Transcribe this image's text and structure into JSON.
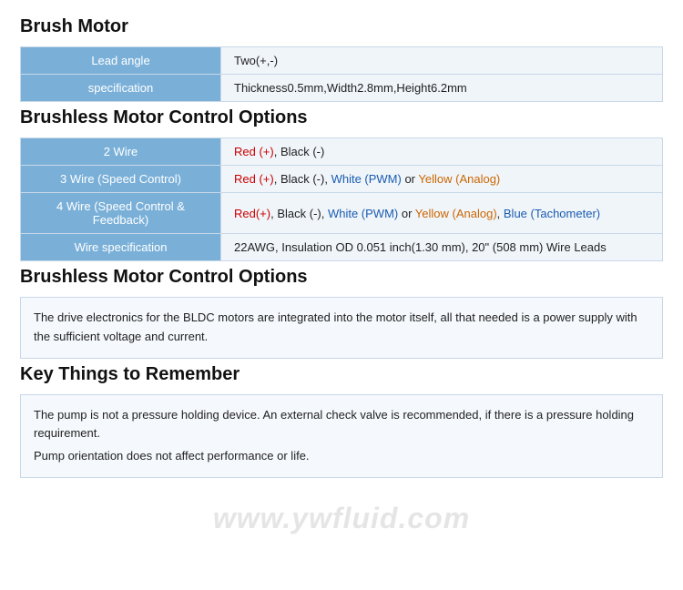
{
  "sections": {
    "brush_motor": {
      "title": "Brush Motor",
      "rows": [
        {
          "label": "Lead angle",
          "value_plain": "Two(+,-)"
        },
        {
          "label": "specification",
          "value_plain": "Thickness0.5mm,Width2.8mm,Height6.2mm"
        }
      ]
    },
    "brushless_control_options": {
      "title": "Brushless Motor Control Options",
      "rows": [
        {
          "label": "2 Wire",
          "value_html": "<span class='red'>Red (+)</span>, <span>Black (-)</span>"
        },
        {
          "label": "3 Wire (Speed Control)",
          "value_html": "<span class='red'>Red (+)</span>, Black (-), <span class='blue'>White (PWM)</span> or <span class='orange'>Yellow (Analog)</span>"
        },
        {
          "label": "4 Wire (Speed Control & Feedback)",
          "value_html": "<span class='red'>Red(+)</span>, Black (-), <span class='blue'>White (PWM)</span> or <span class='orange'>Yellow (Analog)</span>, <span class='blue'>Blue (Tachometer)</span>"
        },
        {
          "label": "Wire specification",
          "value_html": "22AWG, Insulation OD 0.051 inch(1.30 mm), 20\" (508 mm) Wire Leads"
        }
      ]
    },
    "brushless_description": {
      "title": "Brushless Motor Control Options",
      "description": "The drive electronics for the BLDC motors are integrated into the motor itself, all that needed is a power supply with the sufficient voltage and current."
    },
    "key_things": {
      "title": "Key Things to Remember",
      "lines": [
        "The pump is not a pressure holding device. An external check valve is recommended, if there is a pressure holding requirement.",
        "Pump orientation does not affect performance or life."
      ]
    }
  },
  "watermark": "www.ywfluid.com"
}
